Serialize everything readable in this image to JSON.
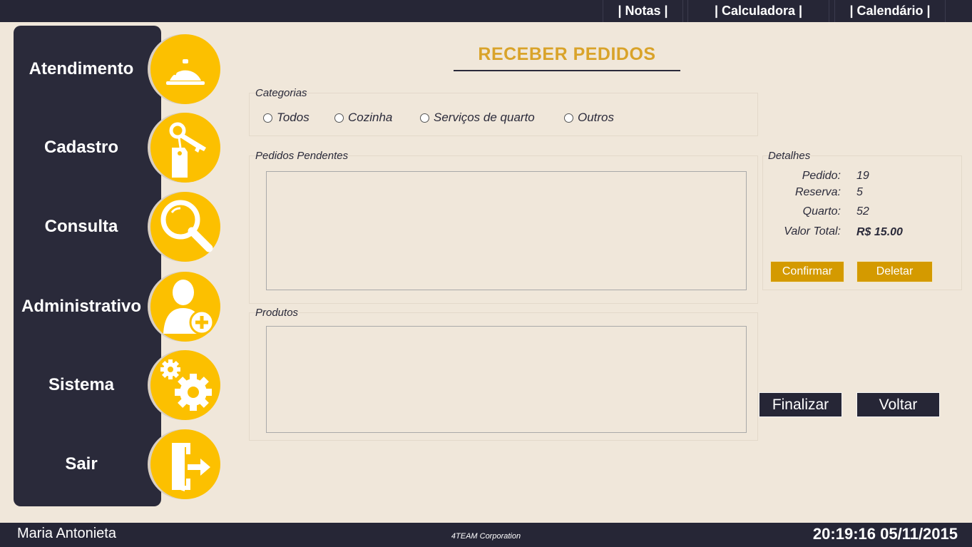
{
  "topbar": {
    "notas": "| Notas |",
    "calculadora": "| Calculadora |",
    "calendario": "| Calendário |"
  },
  "sidebar": {
    "items": [
      {
        "label": "Atendimento",
        "icon": "service-bell-icon"
      },
      {
        "label": "Cadastro",
        "icon": "key-tag-icon"
      },
      {
        "label": "Consulta",
        "icon": "magnifier-icon"
      },
      {
        "label": "Administrativo",
        "icon": "add-user-icon"
      },
      {
        "label": "Sistema",
        "icon": "gears-icon"
      },
      {
        "label": "Sair",
        "icon": "exit-door-icon"
      }
    ]
  },
  "page": {
    "title": "RECEBER PEDIDOS"
  },
  "categorias": {
    "label": "Categorias",
    "options": [
      "Todos",
      "Cozinha",
      "Serviços de quarto",
      "Outros"
    ]
  },
  "pendentes": {
    "label": "Pedidos Pendentes"
  },
  "produtos": {
    "label": "Produtos"
  },
  "detalhes": {
    "label": "Detalhes",
    "pedido_label": "Pedido:",
    "pedido_value": "19",
    "reserva_label": "Reserva:",
    "reserva_value": "5",
    "quarto_label": "Quarto:",
    "quarto_value": "52",
    "valor_label": "Valor Total:",
    "valor_value": "R$ 15.00",
    "confirmar": "Confirmar",
    "deletar": "Deletar"
  },
  "actions": {
    "finalizar": "Finalizar",
    "voltar": "Voltar"
  },
  "footer": {
    "user": "Maria Antonieta",
    "corp": "4TEAM Corporation",
    "datetime": "20:19:16 05/11/2015"
  },
  "colors": {
    "background": "#f0e7da",
    "dark": "#262636",
    "gold": "#fcc000",
    "title": "#d9a32a",
    "button_gold": "#d49a00"
  }
}
